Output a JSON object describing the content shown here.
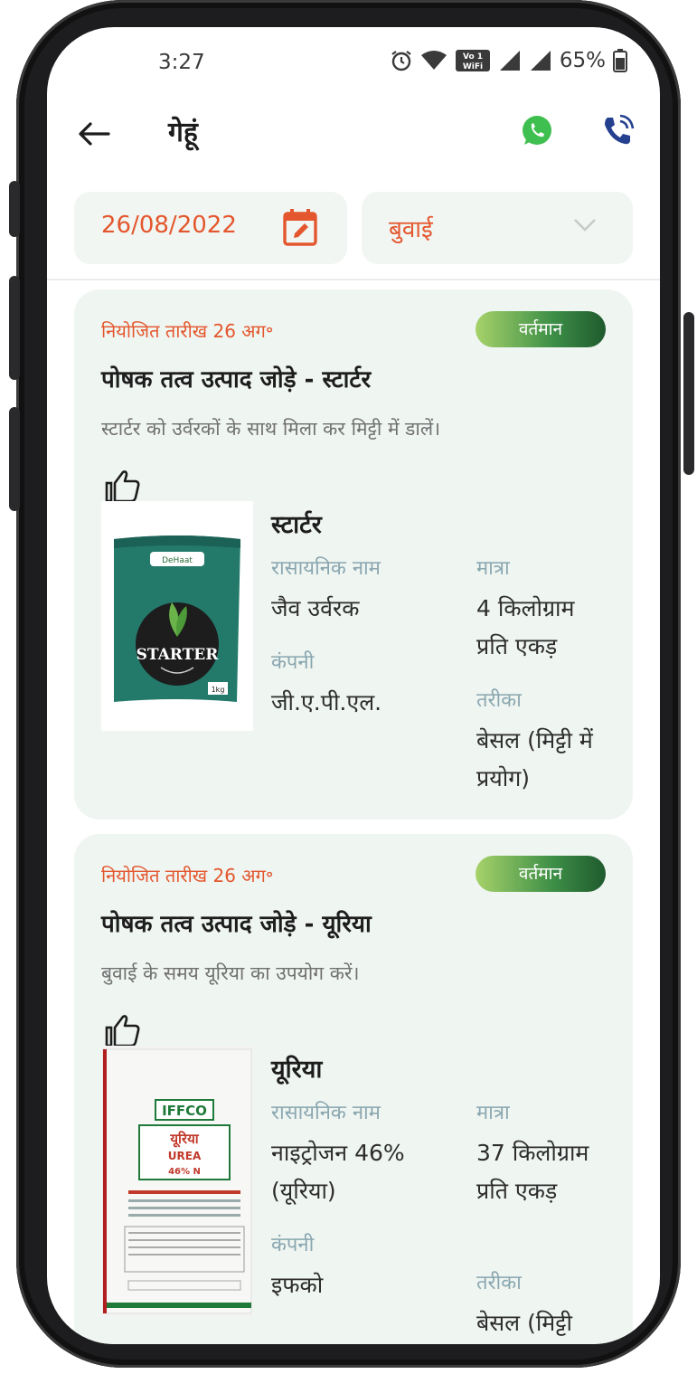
{
  "status_bar": {
    "time": "3:27",
    "battery": "65%"
  },
  "header": {
    "title": "गेहूं",
    "back_icon": "arrow-left-icon",
    "whatsapp_icon": "whatsapp-icon",
    "call_icon": "phone-call-icon"
  },
  "filters": {
    "date": "26/08/2022",
    "stage": "बुवाई"
  },
  "cards": [
    {
      "schedule": "नियोजित तारीख 26 अग॰",
      "badge": "वर्तमान",
      "title": "पोषक तत्व उत्पाद जोड़े - स्टार्टर",
      "description": "स्टार्टर को उर्वरकों के साथ मिला कर मिट्टी में डालें।",
      "product": {
        "name": "स्टार्टर",
        "chemical_label": "रासायनिक नाम",
        "chemical_value": "जैव उर्वरक",
        "company_label": "कंपनी",
        "company_value": "जी.ए.पी.एल.",
        "qty_label": "मात्रा",
        "qty_value": "4 किलोग्राम प्रति एकड़",
        "method_label": "तरीका",
        "method_value": "बेसल (मिट्टी में प्रयोग)",
        "bag_brand": "DeHaat",
        "bag_text": "STARTER",
        "bag_weight": "1kg"
      }
    },
    {
      "schedule": "नियोजित तारीख 26 अग॰",
      "badge": "वर्तमान",
      "title": "पोषक तत्व उत्पाद जोड़े - यूरिया",
      "description": "बुवाई के समय यूरिया का उपयोग करें।",
      "product": {
        "name": "यूरिया",
        "chemical_label": "रासायनिक नाम",
        "chemical_value": "नाइट्रोजन 46% (यूरिया)",
        "company_label": "कंपनी",
        "company_value": "इफको",
        "qty_label": "मात्रा",
        "qty_value": "37 किलोग्राम प्रति एकड़",
        "method_label": "तरीका",
        "method_value": "बेसल (मिट्टी",
        "bag_brand": "IFFCO",
        "bag_hindi": "यूरिया",
        "bag_text": "UREA",
        "bag_n": "46% N"
      }
    }
  ],
  "colors": {
    "accent": "#e4572e",
    "card_bg": "#eff5f1",
    "badge_dark": "#1f5a2e",
    "badge_light": "#a7d26a",
    "label": "#8aa7b0"
  }
}
